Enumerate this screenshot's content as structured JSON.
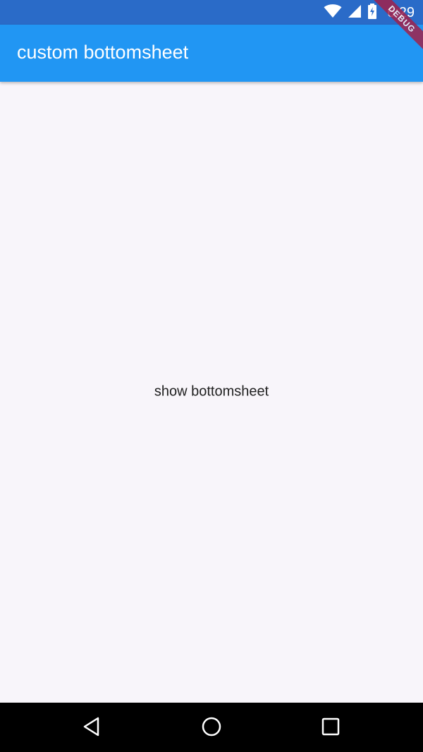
{
  "status_bar": {
    "time": "6:29",
    "icons": [
      "wifi-icon",
      "signal-icon",
      "battery-charging-icon"
    ]
  },
  "app_bar": {
    "title": "custom bottomsheet"
  },
  "main": {
    "button_label": "show bottomsheet"
  },
  "debug_banner": {
    "label": "DEBUG"
  },
  "nav_bar": {
    "icons": [
      "back-icon",
      "home-icon",
      "recent-apps-icon"
    ]
  },
  "colors": {
    "status_bar": "#2a6bc8",
    "app_bar": "#2196f3",
    "background": "#f8f5fa",
    "debug_ribbon": "#a0224c",
    "nav_bar": "#000000"
  }
}
